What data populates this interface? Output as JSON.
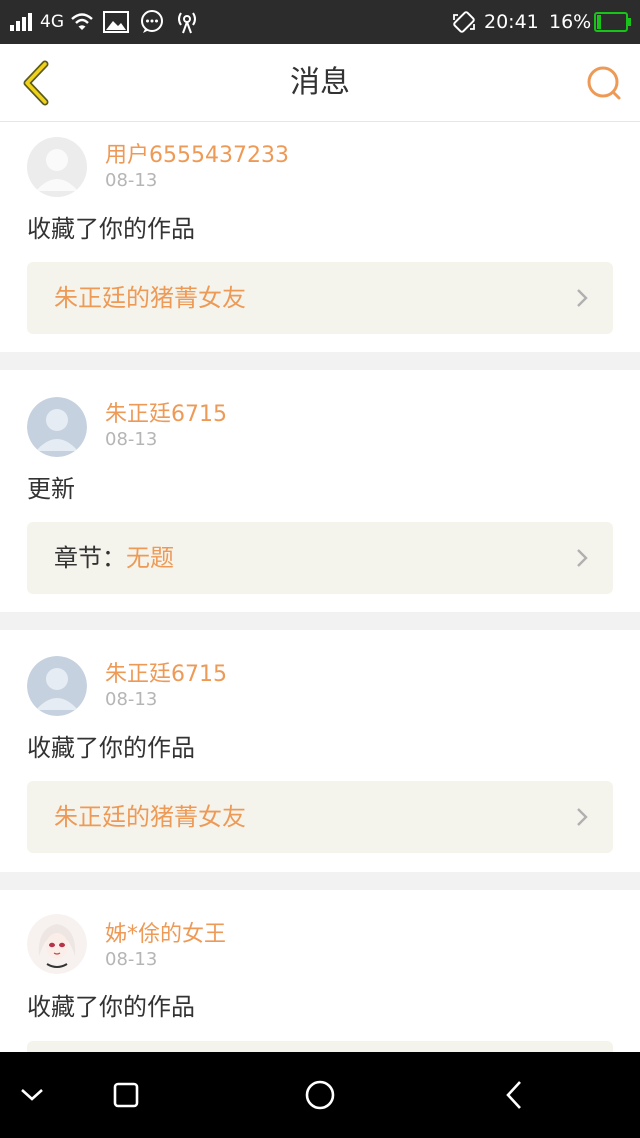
{
  "status_bar": {
    "network": "4G",
    "time": "20:41",
    "battery": "16%",
    "battery_level": 0.16,
    "battery_color": "#19c419"
  },
  "header": {
    "title": "消息",
    "accent_color": "#ee9a57"
  },
  "messages": [
    {
      "username": "用户6555437233",
      "date": "08-13",
      "action": "收藏了你的作品",
      "ref_prefix": "",
      "ref_title": "朱正廷的猪菁女友",
      "avatar": "default-avatar-gray"
    },
    {
      "username": "朱正廷6715",
      "date": "08-13",
      "action": "更新",
      "ref_prefix": "章节：",
      "ref_title": "无题",
      "avatar": "default-avatar-blue"
    },
    {
      "username": "朱正廷6715",
      "date": "08-13",
      "action": "收藏了你的作品",
      "ref_prefix": "",
      "ref_title": "朱正廷的猪菁女友",
      "avatar": "default-avatar-blue"
    },
    {
      "username": "姊*俆的女王",
      "date": "08-13",
      "action": "收藏了你的作品",
      "ref_prefix": "",
      "ref_title": "",
      "avatar": "anime-girl-avatar"
    }
  ],
  "nav_bar": {
    "icons": [
      "collapse-chevron-icon",
      "recents-square-icon",
      "home-circle-icon",
      "back-chevron-icon"
    ]
  }
}
